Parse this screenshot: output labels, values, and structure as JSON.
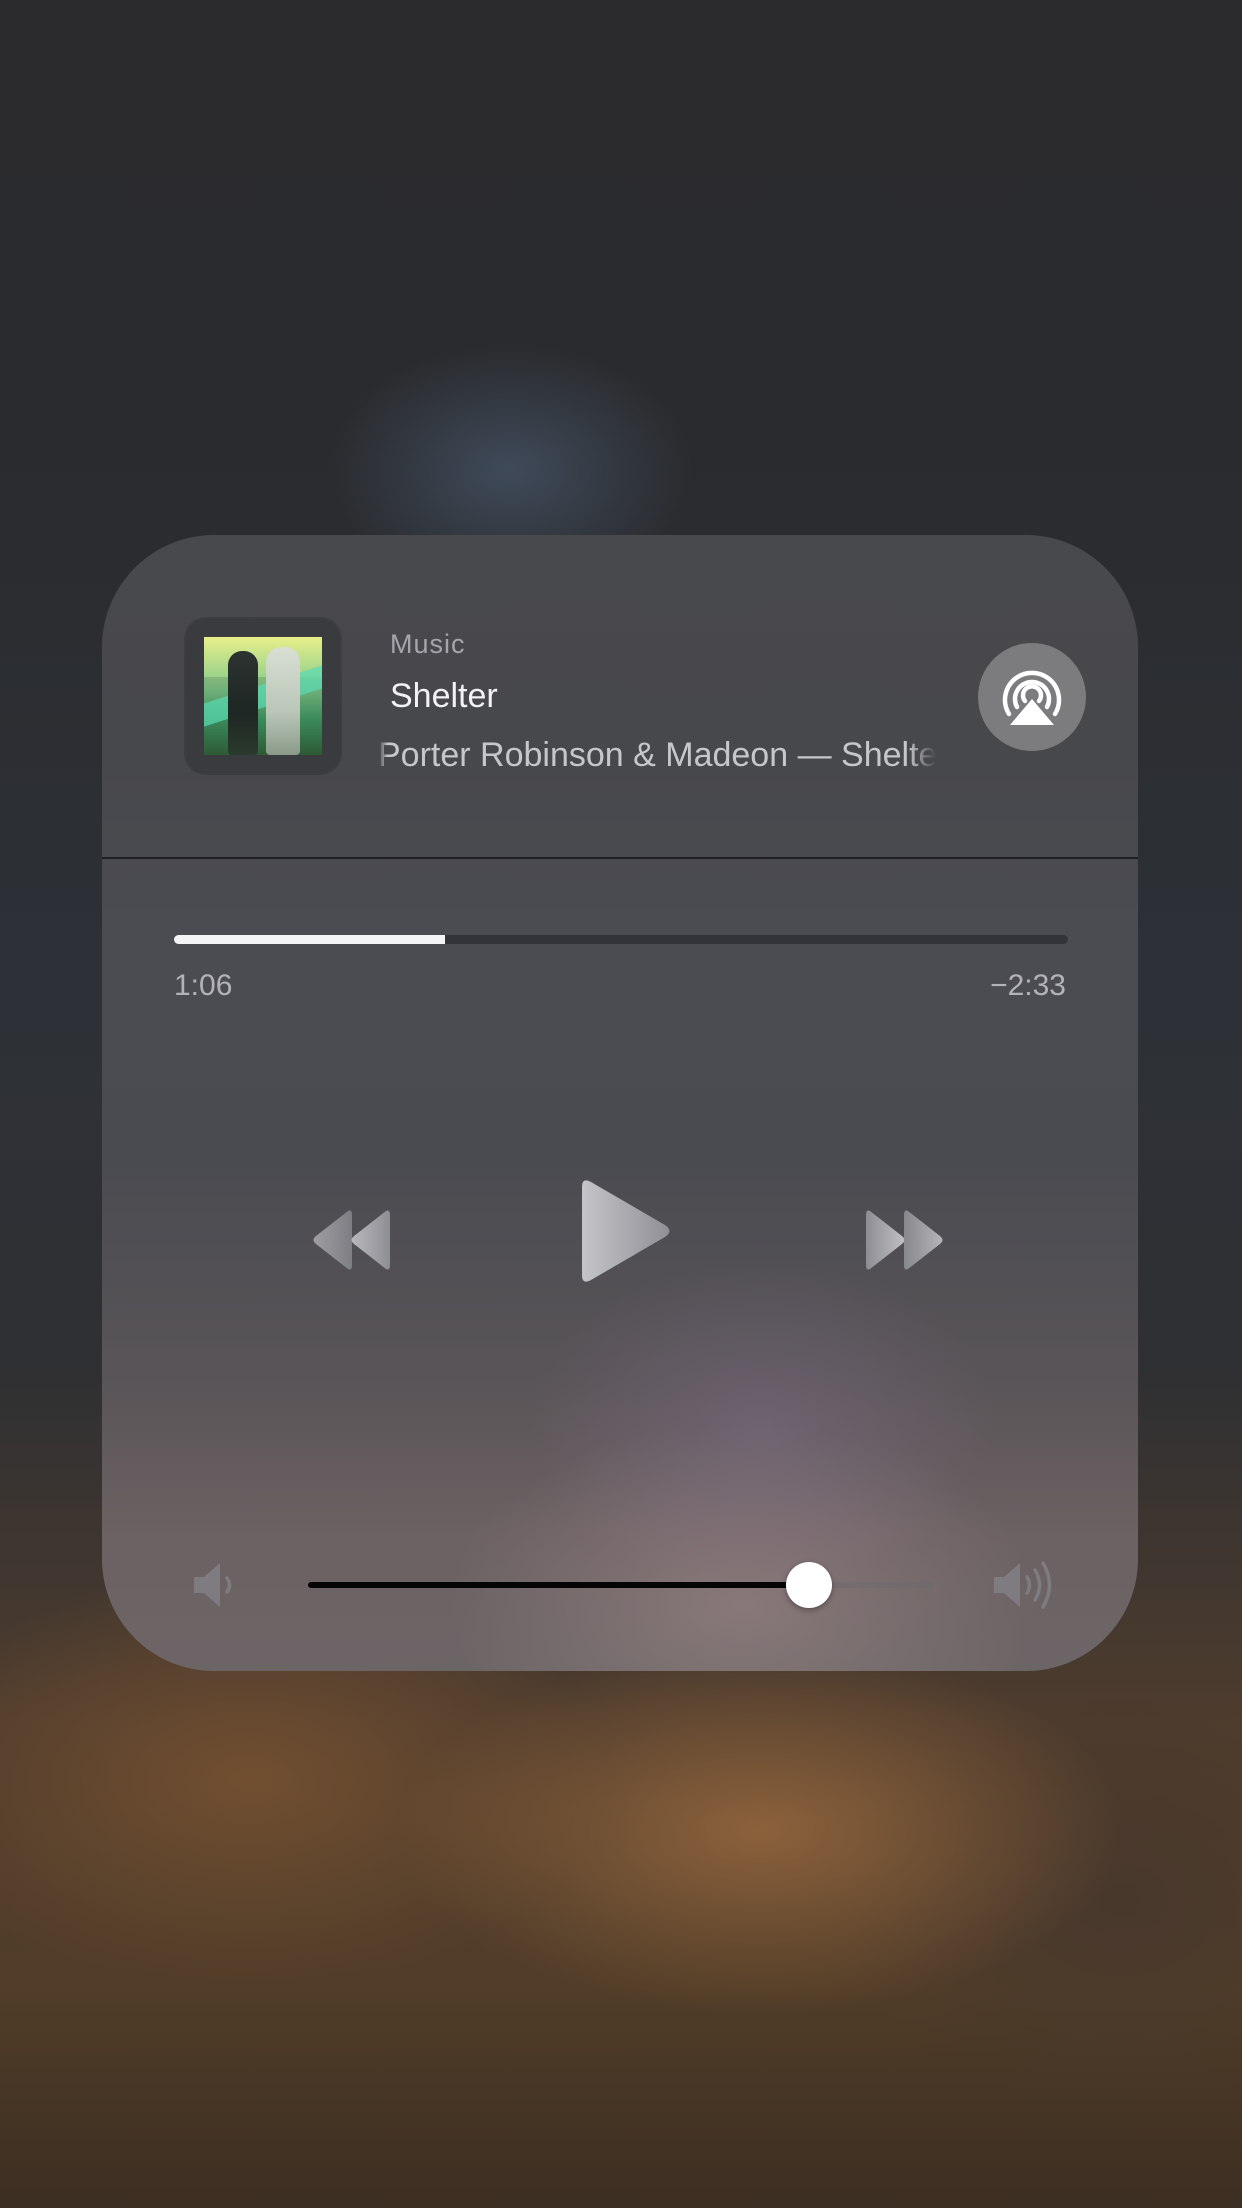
{
  "now_playing": {
    "source_app": "Music",
    "title": "Shelter",
    "artist_album": "Porter Robinson & Madeon — Shelter"
  },
  "playback": {
    "elapsed": "1:06",
    "remaining": "−2:33",
    "progress_fraction": 0.303,
    "state": "paused"
  },
  "volume": {
    "level_fraction": 0.8
  },
  "icons": {
    "airplay": "airplay-audio-icon",
    "previous": "rewind-icon",
    "play": "play-icon",
    "next": "fast-forward-icon",
    "volume_low": "speaker-low-icon",
    "volume_high": "speaker-high-icon"
  },
  "colors": {
    "progress_fill": "#f4f4f6",
    "volume_fill": "#050505",
    "airplay_button": "#7c7b7e"
  }
}
